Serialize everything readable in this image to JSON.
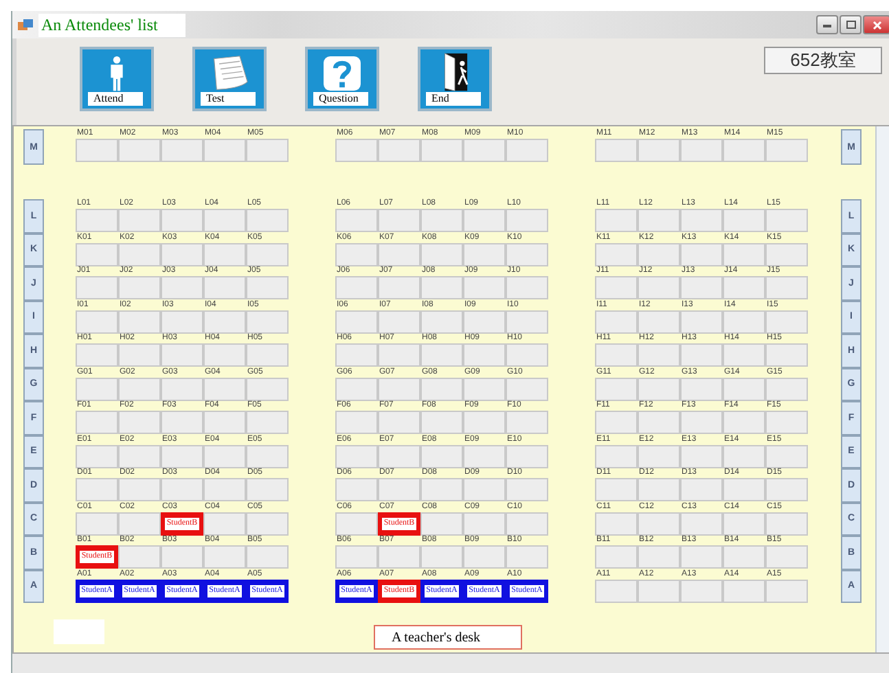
{
  "window": {
    "title": "An Attendees' list"
  },
  "toolbar": [
    {
      "label": "Attend",
      "kind": "person"
    },
    {
      "label": "Test",
      "kind": "paper"
    },
    {
      "label": "Question",
      "kind": "question"
    },
    {
      "label": "End",
      "kind": "exit"
    }
  ],
  "room": "652教室",
  "rows": [
    {
      "left_label": "M",
      "right_label": "M",
      "seats": [
        {
          "label": "M01"
        },
        {
          "label": "M02"
        },
        {
          "label": "M03"
        },
        {
          "label": "M04"
        },
        {
          "label": "M05"
        },
        {
          "label": "M06"
        },
        {
          "label": "M07"
        },
        {
          "label": "M08"
        },
        {
          "label": "M09"
        },
        {
          "label": "M10"
        },
        {
          "label": "M11"
        },
        {
          "label": "M12"
        },
        {
          "label": "M13"
        },
        {
          "label": "M14"
        },
        {
          "label": "M15"
        }
      ]
    },
    {
      "left_label": "L",
      "right_label": "L",
      "seats": [
        {
          "label": "L01"
        },
        {
          "label": "L02"
        },
        {
          "label": "L03"
        },
        {
          "label": "L04"
        },
        {
          "label": "L05"
        },
        {
          "label": "L06"
        },
        {
          "label": "L07"
        },
        {
          "label": "L08"
        },
        {
          "label": "L09"
        },
        {
          "label": "L10"
        },
        {
          "label": "L11"
        },
        {
          "label": "L12"
        },
        {
          "label": "L13"
        },
        {
          "label": "L14"
        },
        {
          "label": "L15"
        }
      ]
    },
    {
      "left_label": "K",
      "right_label": "K",
      "seats": [
        {
          "label": "K01"
        },
        {
          "label": "K02"
        },
        {
          "label": "K03"
        },
        {
          "label": "K04"
        },
        {
          "label": "K05"
        },
        {
          "label": "K06"
        },
        {
          "label": "K07"
        },
        {
          "label": "K08"
        },
        {
          "label": "K09"
        },
        {
          "label": "K10"
        },
        {
          "label": "K11"
        },
        {
          "label": "K12"
        },
        {
          "label": "K13"
        },
        {
          "label": "K14"
        },
        {
          "label": "K15"
        }
      ]
    },
    {
      "left_label": "J",
      "right_label": "J",
      "seats": [
        {
          "label": "J01"
        },
        {
          "label": "J02"
        },
        {
          "label": "J03"
        },
        {
          "label": "J04"
        },
        {
          "label": "J05"
        },
        {
          "label": "J06"
        },
        {
          "label": "J07"
        },
        {
          "label": "J08"
        },
        {
          "label": "J09"
        },
        {
          "label": "J10"
        },
        {
          "label": "J11"
        },
        {
          "label": "J12"
        },
        {
          "label": "J13"
        },
        {
          "label": "J14"
        },
        {
          "label": "J15"
        }
      ]
    },
    {
      "left_label": "I",
      "right_label": "I",
      "seats": [
        {
          "label": "I01"
        },
        {
          "label": "I02"
        },
        {
          "label": "I03"
        },
        {
          "label": "I04"
        },
        {
          "label": "I05"
        },
        {
          "label": "I06"
        },
        {
          "label": "I07"
        },
        {
          "label": "I08"
        },
        {
          "label": "I09"
        },
        {
          "label": "I10"
        },
        {
          "label": "I11"
        },
        {
          "label": "I12"
        },
        {
          "label": "I13"
        },
        {
          "label": "I14"
        },
        {
          "label": "I15"
        }
      ]
    },
    {
      "left_label": "H",
      "right_label": "H",
      "seats": [
        {
          "label": "H01"
        },
        {
          "label": "H02"
        },
        {
          "label": "H03"
        },
        {
          "label": "H04"
        },
        {
          "label": "H05"
        },
        {
          "label": "H06"
        },
        {
          "label": "H07"
        },
        {
          "label": "H08"
        },
        {
          "label": "H09"
        },
        {
          "label": "H10"
        },
        {
          "label": "H11"
        },
        {
          "label": "H12"
        },
        {
          "label": "H13"
        },
        {
          "label": "H14"
        },
        {
          "label": "H15"
        }
      ]
    },
    {
      "left_label": "G",
      "right_label": "G",
      "seats": [
        {
          "label": "G01"
        },
        {
          "label": "G02"
        },
        {
          "label": "G03"
        },
        {
          "label": "G04"
        },
        {
          "label": "G05"
        },
        {
          "label": "G06"
        },
        {
          "label": "G07"
        },
        {
          "label": "G08"
        },
        {
          "label": "G09"
        },
        {
          "label": "G10"
        },
        {
          "label": "G11"
        },
        {
          "label": "G12"
        },
        {
          "label": "G13"
        },
        {
          "label": "G14"
        },
        {
          "label": "G15"
        }
      ]
    },
    {
      "left_label": "F",
      "right_label": "F",
      "seats": [
        {
          "label": "F01"
        },
        {
          "label": "F02"
        },
        {
          "label": "F03"
        },
        {
          "label": "F04"
        },
        {
          "label": "F05"
        },
        {
          "label": "F06"
        },
        {
          "label": "F07"
        },
        {
          "label": "F08"
        },
        {
          "label": "F09"
        },
        {
          "label": "F10"
        },
        {
          "label": "F11"
        },
        {
          "label": "F12"
        },
        {
          "label": "F13"
        },
        {
          "label": "F14"
        },
        {
          "label": "F15"
        }
      ]
    },
    {
      "left_label": "E",
      "right_label": "E",
      "seats": [
        {
          "label": "E01"
        },
        {
          "label": "E02"
        },
        {
          "label": "E03"
        },
        {
          "label": "E04"
        },
        {
          "label": "E05"
        },
        {
          "label": "E06"
        },
        {
          "label": "E07"
        },
        {
          "label": "E08"
        },
        {
          "label": "E09"
        },
        {
          "label": "E10"
        },
        {
          "label": "E11"
        },
        {
          "label": "E12"
        },
        {
          "label": "E13"
        },
        {
          "label": "E14"
        },
        {
          "label": "E15"
        }
      ]
    },
    {
      "left_label": "D",
      "right_label": "D",
      "seats": [
        {
          "label": "D01"
        },
        {
          "label": "D02"
        },
        {
          "label": "D03"
        },
        {
          "label": "D04"
        },
        {
          "label": "D05"
        },
        {
          "label": "D06"
        },
        {
          "label": "D07"
        },
        {
          "label": "D08"
        },
        {
          "label": "D09"
        },
        {
          "label": "D10"
        },
        {
          "label": "D11"
        },
        {
          "label": "D12"
        },
        {
          "label": "D13"
        },
        {
          "label": "D14"
        },
        {
          "label": "D15"
        }
      ]
    },
    {
      "left_label": "C",
      "right_label": "C",
      "seats": [
        {
          "label": "C01"
        },
        {
          "label": "C02"
        },
        {
          "label": "C03",
          "student": "StudentB",
          "kind": "b"
        },
        {
          "label": "C04"
        },
        {
          "label": "C05"
        },
        {
          "label": "C06"
        },
        {
          "label": "C07",
          "student": "StudentB",
          "kind": "b"
        },
        {
          "label": "C08"
        },
        {
          "label": "C09"
        },
        {
          "label": "C10"
        },
        {
          "label": "C11"
        },
        {
          "label": "C12"
        },
        {
          "label": "C13"
        },
        {
          "label": "C14"
        },
        {
          "label": "C15"
        }
      ]
    },
    {
      "left_label": "B",
      "right_label": "B",
      "seats": [
        {
          "label": "B01",
          "student": "StudentB",
          "kind": "b"
        },
        {
          "label": "B02"
        },
        {
          "label": "B03"
        },
        {
          "label": "B04"
        },
        {
          "label": "B05"
        },
        {
          "label": "B06"
        },
        {
          "label": "B07"
        },
        {
          "label": "B08"
        },
        {
          "label": "B09"
        },
        {
          "label": "B10"
        },
        {
          "label": "B11"
        },
        {
          "label": "B12"
        },
        {
          "label": "B13"
        },
        {
          "label": "B14"
        },
        {
          "label": "B15"
        }
      ]
    },
    {
      "left_label": "A",
      "right_label": "A",
      "seats": [
        {
          "label": "A01",
          "student": "StudentA",
          "kind": "a"
        },
        {
          "label": "A02",
          "student": "StudentA",
          "kind": "a"
        },
        {
          "label": "A03",
          "student": "StudentA",
          "kind": "a"
        },
        {
          "label": "A04",
          "student": "StudentA",
          "kind": "a"
        },
        {
          "label": "A05",
          "student": "StudentA",
          "kind": "a"
        },
        {
          "label": "A06",
          "student": "StudentA",
          "kind": "a"
        },
        {
          "label": "A07",
          "student": "StudentB",
          "kind": "b"
        },
        {
          "label": "A08",
          "student": "StudentA",
          "kind": "a"
        },
        {
          "label": "A09",
          "student": "StudentA",
          "kind": "a"
        },
        {
          "label": "A10",
          "student": "StudentA",
          "kind": "a"
        },
        {
          "label": "A11"
        },
        {
          "label": "A12"
        },
        {
          "label": "A13"
        },
        {
          "label": "A14"
        },
        {
          "label": "A15"
        }
      ]
    }
  ],
  "teacher_desk": "A teacher's desk"
}
